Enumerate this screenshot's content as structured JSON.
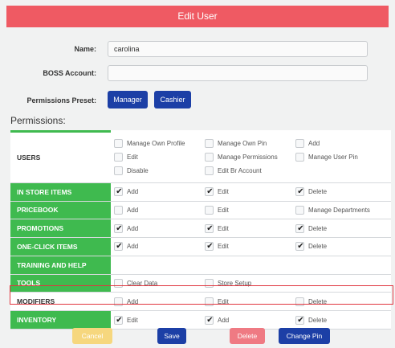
{
  "header": {
    "title": "Edit User"
  },
  "form": {
    "name_label": "Name:",
    "name_value": "carolina",
    "boss_label": "BOSS Account:",
    "boss_value": "",
    "preset_label": "Permissions Preset:",
    "preset_buttons": [
      "Manager",
      "Cashier"
    ]
  },
  "permissions": {
    "title": "Permissions:",
    "rows": [
      {
        "name": "USERS",
        "options": [
          {
            "label": "Manage Own Profile",
            "checked": false
          },
          {
            "label": "Manage Own Pin",
            "checked": false
          },
          {
            "label": "Add",
            "checked": false
          },
          {
            "label": "Edit",
            "checked": false
          },
          {
            "label": "Manage Permissions",
            "checked": false
          },
          {
            "label": "Manage User Pin",
            "checked": false
          },
          {
            "label": "Disable",
            "checked": false
          },
          {
            "label": "Edit Br Account",
            "checked": false
          }
        ]
      },
      {
        "name": "IN STORE ITEMS",
        "options": [
          {
            "label": "Add",
            "checked": true
          },
          {
            "label": "Edit",
            "checked": true
          },
          {
            "label": "Delete",
            "checked": true
          }
        ]
      },
      {
        "name": "PRICEBOOK",
        "options": [
          {
            "label": "Add",
            "checked": false
          },
          {
            "label": "Edit",
            "checked": false
          },
          {
            "label": "Manage Departments",
            "checked": false
          }
        ]
      },
      {
        "name": "PROMOTIONS",
        "options": [
          {
            "label": "Add",
            "checked": true
          },
          {
            "label": "Edit",
            "checked": true
          },
          {
            "label": "Delete",
            "checked": true
          }
        ]
      },
      {
        "name": "ONE-CLICK ITEMS",
        "options": [
          {
            "label": "Add",
            "checked": true
          },
          {
            "label": "Edit",
            "checked": true
          },
          {
            "label": "Delete",
            "checked": true
          }
        ]
      },
      {
        "name": "TRAINING AND HELP",
        "options": []
      },
      {
        "name": "TOOLS",
        "options": [
          {
            "label": "Clear Data",
            "checked": false
          },
          {
            "label": "Store Setup",
            "checked": false
          }
        ]
      },
      {
        "name": "MODIFIERS",
        "options": [
          {
            "label": "Add",
            "checked": false
          },
          {
            "label": "Edit",
            "checked": false
          },
          {
            "label": "Delete",
            "checked": false
          }
        ]
      },
      {
        "name": "INVENTORY",
        "options": [
          {
            "label": "Edit",
            "checked": true
          },
          {
            "label": "Add",
            "checked": true
          },
          {
            "label": "Delete",
            "checked": true
          }
        ]
      }
    ]
  },
  "footer": {
    "cancel_label": "Cancel",
    "save_label": "Save",
    "delete_label": "Delete",
    "change_pin_label": "Change Pin"
  },
  "colors": {
    "title_bar": "#ef5a63",
    "category_green": "#3fba4f",
    "primary_blue": "#1c3fa6",
    "cancel_yellow": "#f6d77e",
    "delete_red": "#ef7a83",
    "highlight_red": "#e0353f"
  }
}
